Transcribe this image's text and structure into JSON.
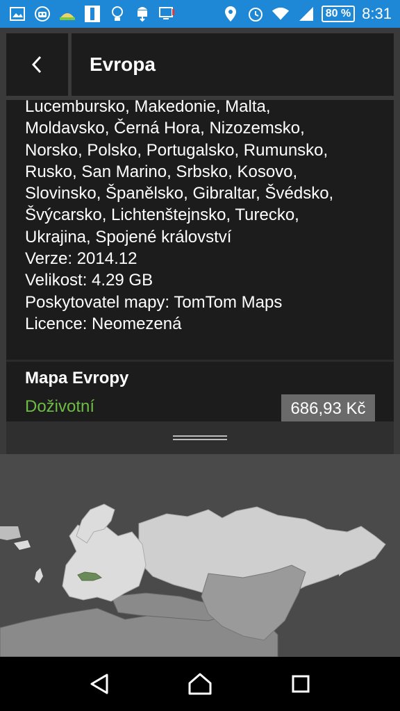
{
  "status_bar": {
    "battery": "80 %",
    "time": "8:31"
  },
  "header": {
    "title": "Evropa"
  },
  "details": {
    "lines": [
      "Lucembursko, Makedonie, Malta,",
      "Moldavsko, Černá Hora, Nizozemsko,",
      "Norsko, Polsko, Portugalsko, Rumunsko,",
      "Rusko, San Marino, Srbsko, Kosovo,",
      "Slovinsko, Španělsko, Gibraltar, Švédsko,",
      "Švýcarsko, Lichtenštejnsko, Turecko,",
      "Ukrajina, Spojené království",
      "Verze: 2014.12",
      "Velikost: 4.29 GB",
      "Poskytovatel mapy: TomTom Maps",
      "Licence: Neomezená"
    ]
  },
  "product": {
    "name": "Mapa Evropy",
    "term": "Doživotní",
    "price": "686,93 Kč"
  },
  "colors": {
    "status_bar": "#1e88d6",
    "panel": "#1c1c1c",
    "accent_green": "#6dbd45",
    "price_button": "#6a6a6a",
    "map_background": "#4a4a4a"
  },
  "icons": {
    "back": "chevron-left-icon",
    "nav_back": "triangle-back-icon",
    "nav_home": "home-icon",
    "nav_recent": "square-recent-icon"
  }
}
